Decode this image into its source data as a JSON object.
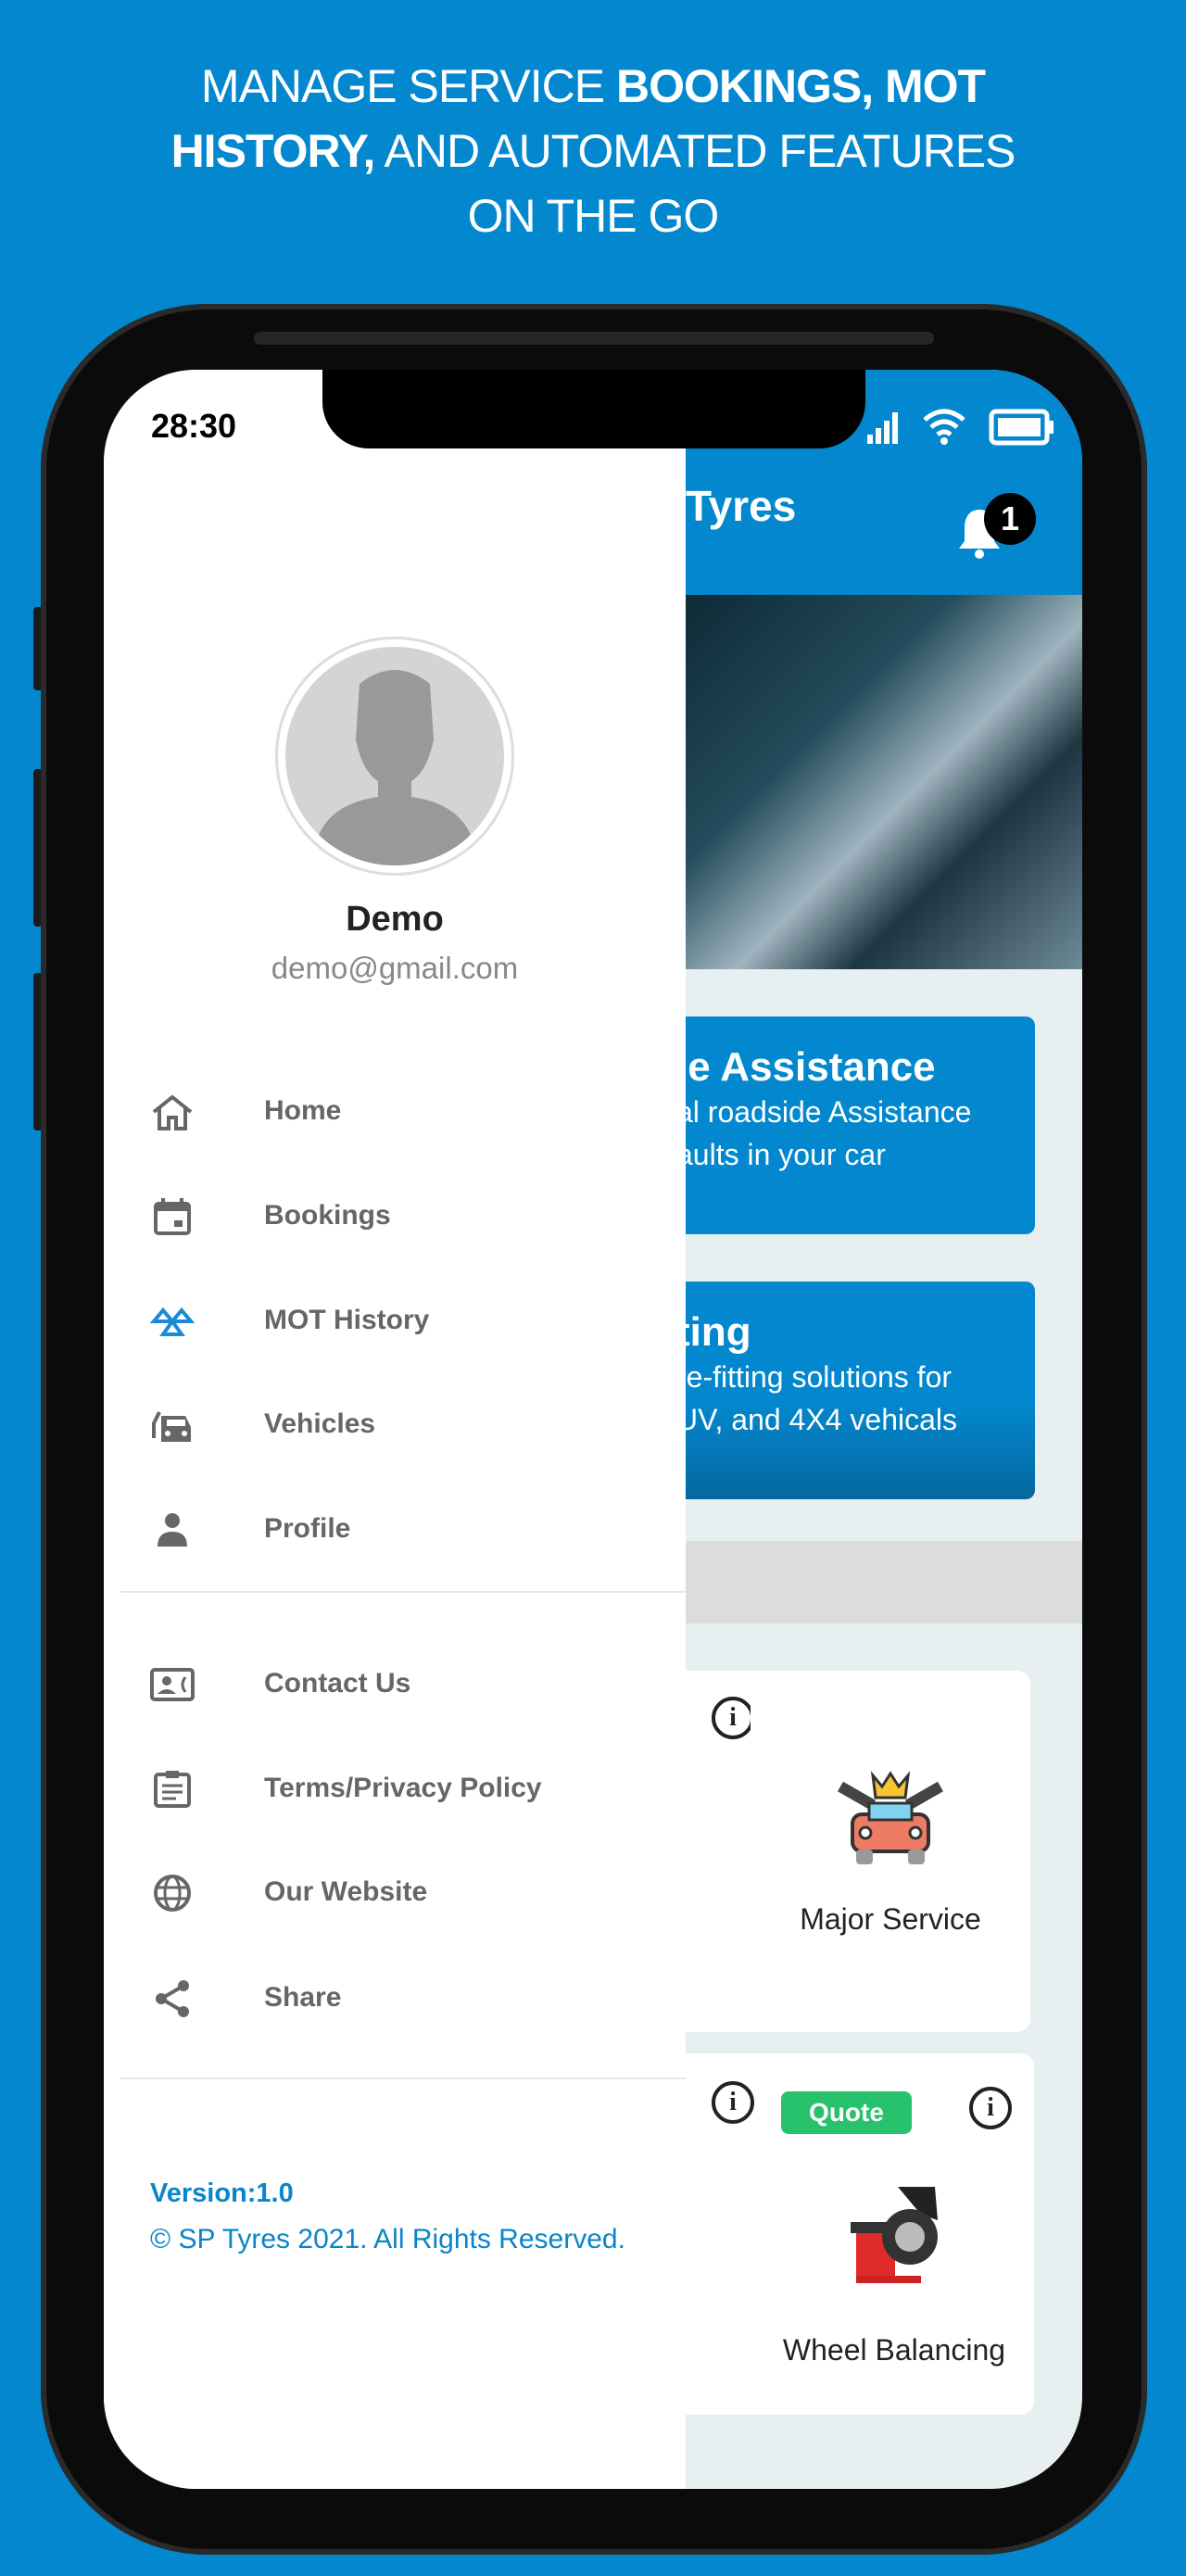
{
  "headline": {
    "part1": "MANAGE SERVICE ",
    "bold1": "BOOKINGS, MOT",
    "bold2": "HISTORY,",
    "part2": " AND AUTOMATED FEATURES",
    "part3": "ON THE GO"
  },
  "status": {
    "time": "28:30"
  },
  "appbar": {
    "title": "Tyres",
    "notification_count": "1"
  },
  "promos": [
    {
      "title": "le Assistance",
      "line1": "al roadside Assistance",
      "line2": "aults in your car"
    },
    {
      "title": "ting",
      "line1": "re-fitting solutions for",
      "line2": "UV, and 4X4 vehicals"
    }
  ],
  "services": [
    {
      "label": "Major Service"
    },
    {
      "label": "Wheel Balancing",
      "badge": "Quote"
    }
  ],
  "drawer": {
    "name": "Demo",
    "email": "demo@gmail.com",
    "items": [
      {
        "label": "Home",
        "icon": "home-icon"
      },
      {
        "label": "Bookings",
        "icon": "calendar-icon"
      },
      {
        "label": "MOT History",
        "icon": "mot-icon"
      },
      {
        "label": "Vehicles",
        "icon": "vehicles-icon"
      },
      {
        "label": "Profile",
        "icon": "person-icon"
      }
    ],
    "secondary": [
      {
        "label": "Contact Us",
        "icon": "contact-card-icon"
      },
      {
        "label": "Terms/Privacy Policy",
        "icon": "clipboard-icon"
      },
      {
        "label": "Our Website",
        "icon": "globe-icon"
      },
      {
        "label": "Share",
        "icon": "share-icon"
      }
    ],
    "version": "Version:1.0",
    "copyright": "© SP Tyres 2021. All Rights Reserved."
  },
  "colors": {
    "brand": "#0388cf",
    "quote": "#27c26b",
    "mot_icon": "#1a8ad4"
  }
}
